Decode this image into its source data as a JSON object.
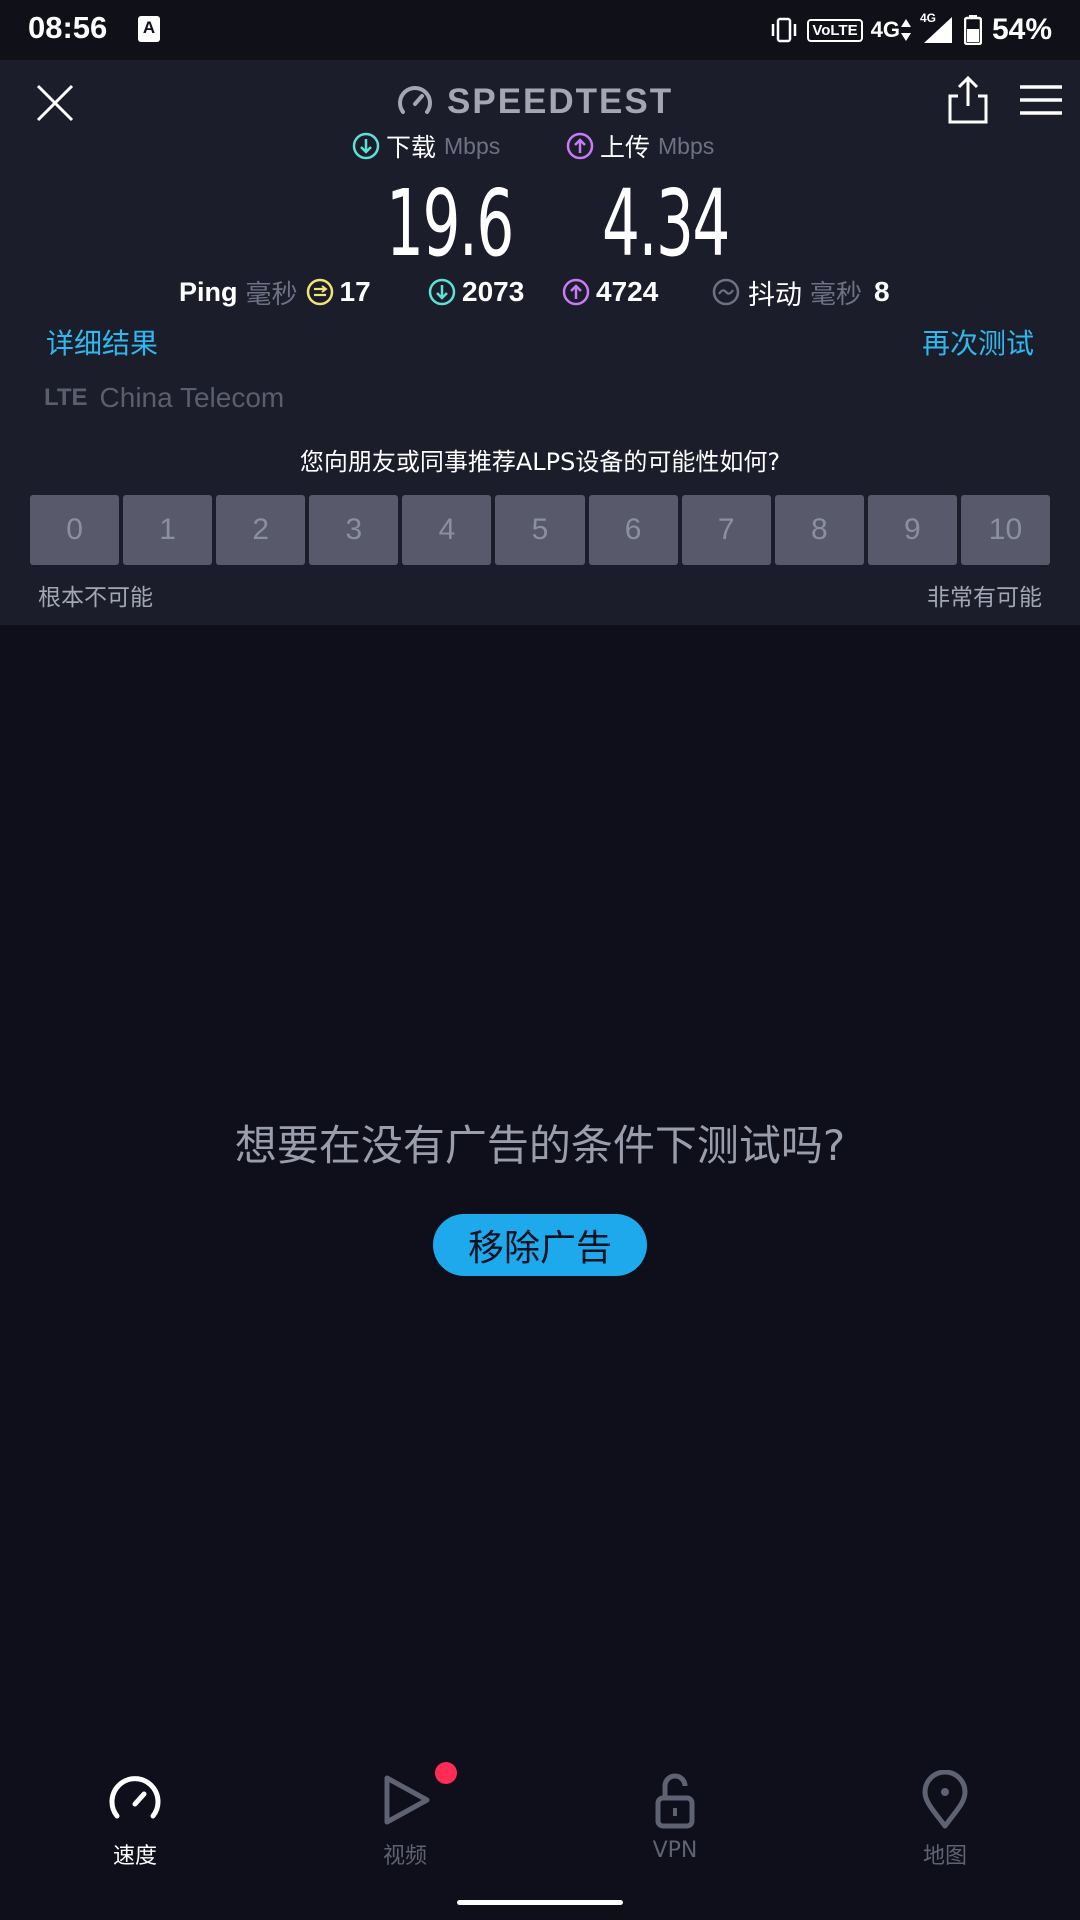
{
  "status_bar": {
    "time": "08:56",
    "notification_icon_letter": "A",
    "volte": "VoLTE",
    "network_primary": "4G",
    "network_secondary": "4G",
    "battery_percent": "54%"
  },
  "header": {
    "logo_text": "SPEEDTEST",
    "close_icon": "close-icon",
    "share_icon": "share-icon",
    "menu_icon": "menu-icon"
  },
  "results": {
    "download_label": "下载",
    "upload_label": "上传",
    "unit": "Mbps",
    "download_value": "19.6",
    "upload_value": "4.34"
  },
  "stats": {
    "ping_label": "Ping",
    "ms_unit": "毫秒",
    "ping_value": "17",
    "download_latency": "2073",
    "upload_latency": "4724",
    "jitter_label": "抖动",
    "jitter_value": "8"
  },
  "links": {
    "detailed_results": "详细结果",
    "test_again": "再次测试"
  },
  "carrier": {
    "tech": "LTE",
    "name": "China Telecom"
  },
  "survey": {
    "question": "您向朋友或同事推荐ALPS设备的可能性如何?",
    "options": [
      "0",
      "1",
      "2",
      "3",
      "4",
      "5",
      "6",
      "7",
      "8",
      "9",
      "10"
    ],
    "low_label": "根本不可能",
    "high_label": "非常有可能"
  },
  "ad": {
    "title": "想要在没有广告的条件下测试吗?",
    "button": "移除广告"
  },
  "bottom_nav": {
    "items": [
      {
        "label": "速度",
        "icon": "speedometer-icon",
        "active": true
      },
      {
        "label": "视频",
        "icon": "play-icon",
        "active": false
      },
      {
        "label": "VPN",
        "icon": "unlock-icon",
        "active": false
      },
      {
        "label": "地图",
        "icon": "map-pin-icon",
        "active": false
      }
    ]
  },
  "colors": {
    "background": "#0f0f1b",
    "panel": "#1c1d2b",
    "accent_blue": "#2fb8ee",
    "download_icon": "#5fe0d6",
    "upload_icon": "#c77cf5",
    "ping_icon": "#f3e27a",
    "badge_red": "#ff2d55"
  }
}
